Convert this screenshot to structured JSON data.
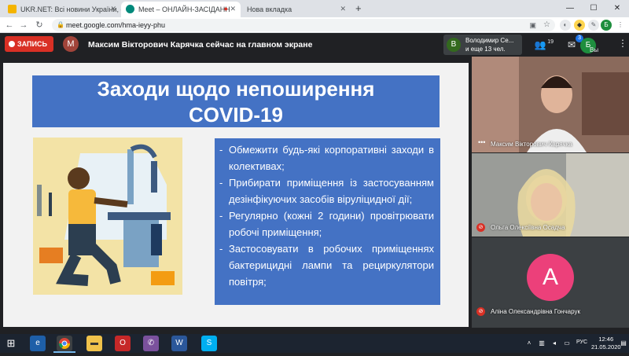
{
  "browser": {
    "tabs": [
      {
        "label": "UKR.NET: Всі новини України, ос",
        "active": false
      },
      {
        "label": "Meet – ОНЛАЙН-ЗАСІДАНН",
        "active": true
      },
      {
        "label": "Нова вкладка",
        "active": false
      }
    ],
    "new_tab": "+",
    "window_controls": {
      "minimize": "—",
      "maximize": "☐",
      "close": "✕"
    },
    "url": "meet.google.com/hma-ieyy-phu",
    "profile_initial": "Б"
  },
  "meet": {
    "record_label": "ЗАПИСЬ",
    "presenter_initial": "M",
    "presenting_text": "Максим Вікторович Карячка сейчас на главном экране",
    "user_chip": {
      "initial": "B",
      "line1": "Володимир Се...",
      "line2": "и еще 13 чел."
    },
    "participants_count": "19",
    "chat_badge": "3",
    "self_initial": "Б",
    "self_label": "Вы",
    "colors": {
      "record": "#d93025",
      "header": "#202124"
    }
  },
  "slide": {
    "title_line1": "Заходи щодо непоширення",
    "title_line2": "COVID-19",
    "bullets": [
      "Обмежити будь-які корпоративні заходи в колективах;",
      "Прибирати приміщення із застосуванням дезінфікуючих засобів віруліцидної дії;",
      "Регулярно (кожні 2 години) провітрювати робочі приміщення;",
      "Застосовувати в робочих приміщеннях бактерицидні лампи та рециркулятори повітря;"
    ],
    "colors": {
      "box": "#4472c4",
      "background": "#f2f2f2",
      "illustration": "#f3e3a6"
    }
  },
  "participants": [
    {
      "name": "Максим Вікторович Карячка",
      "muted": false
    },
    {
      "name": "Ольга Олексіївна Осадча",
      "muted": true
    },
    {
      "name": "Аліна Олександрівна Гончарук",
      "muted": true,
      "initial": "A"
    }
  ],
  "taskbar": {
    "lang": "РУС",
    "time": "12:46",
    "date": "21.05.2020"
  }
}
